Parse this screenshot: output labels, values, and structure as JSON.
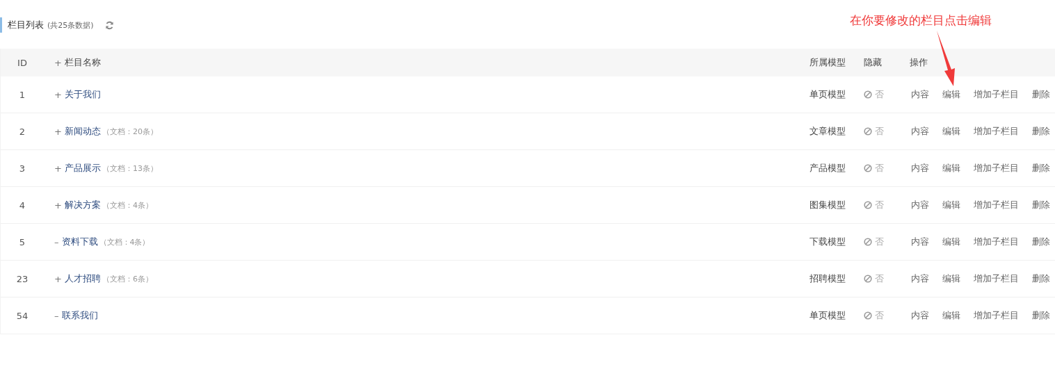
{
  "panel": {
    "title": "栏目列表",
    "count": "(共25条数据)"
  },
  "annotation": {
    "text": "在你要修改的栏目点击编辑"
  },
  "table": {
    "columns": [
      "ID",
      "栏目名称",
      "所属模型",
      "隐藏",
      "操作"
    ],
    "header_toggle": "+",
    "rows": [
      {
        "id": "1",
        "toggle": "+",
        "name": "关于我们",
        "docs": "",
        "model": "单页模型",
        "hidden": "否",
        "actions": [
          "内容",
          "编辑",
          "增加子栏目",
          "删除"
        ]
      },
      {
        "id": "2",
        "toggle": "+",
        "name": "新闻动态",
        "docs": "（文档：20条）",
        "model": "文章模型",
        "hidden": "否",
        "actions": [
          "内容",
          "编辑",
          "增加子栏目",
          "删除"
        ]
      },
      {
        "id": "3",
        "toggle": "+",
        "name": "产品展示",
        "docs": "（文档：13条）",
        "model": "产品模型",
        "hidden": "否",
        "actions": [
          "内容",
          "编辑",
          "增加子栏目",
          "删除"
        ]
      },
      {
        "id": "4",
        "toggle": "+",
        "name": "解决方案",
        "docs": "（文档：4条）",
        "model": "图集模型",
        "hidden": "否",
        "actions": [
          "内容",
          "编辑",
          "增加子栏目",
          "删除"
        ]
      },
      {
        "id": "5",
        "toggle": "–",
        "name": "资料下载",
        "docs": "（文档：4条）",
        "model": "下载模型",
        "hidden": "否",
        "actions": [
          "内容",
          "编辑",
          "增加子栏目",
          "删除"
        ]
      },
      {
        "id": "23",
        "toggle": "+",
        "name": "人才招聘",
        "docs": "（文档：6条）",
        "model": "招聘模型",
        "hidden": "否",
        "actions": [
          "内容",
          "编辑",
          "增加子栏目",
          "删除"
        ]
      },
      {
        "id": "54",
        "toggle": "–",
        "name": "联系我们",
        "docs": "",
        "model": "单页模型",
        "hidden": "否",
        "actions": [
          "内容",
          "编辑",
          "增加子栏目",
          "删除"
        ]
      }
    ]
  }
}
